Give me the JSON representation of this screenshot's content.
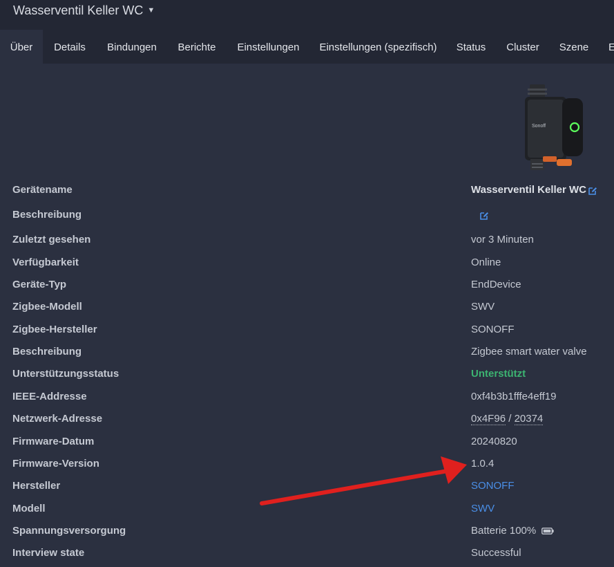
{
  "header": {
    "title": "Wasserventil Keller WC"
  },
  "tabs": [
    {
      "label": "Über",
      "active": true
    },
    {
      "label": "Details"
    },
    {
      "label": "Bindungen"
    },
    {
      "label": "Berichte"
    },
    {
      "label": "Einstellungen"
    },
    {
      "label": "Einstellungen (spezifisch)"
    },
    {
      "label": "Status"
    },
    {
      "label": "Cluster"
    },
    {
      "label": "Szene"
    },
    {
      "label": "E"
    }
  ],
  "device_image": {
    "brand_text": "Sonoff"
  },
  "info": {
    "geraetename": {
      "label": "Gerätename",
      "value": "Wasserventil Keller WC"
    },
    "beschreibung_edit": {
      "label": "Beschreibung"
    },
    "zuletzt": {
      "label": "Zuletzt gesehen",
      "value": "vor 3 Minuten"
    },
    "verfuegbarkeit": {
      "label": "Verfügbarkeit",
      "value": "Online"
    },
    "typ": {
      "label": "Geräte-Typ",
      "value": "EndDevice"
    },
    "modell": {
      "label": "Zigbee-Modell",
      "value": "SWV"
    },
    "hersteller_zb": {
      "label": "Zigbee-Hersteller",
      "value": "SONOFF"
    },
    "beschreibung": {
      "label": "Beschreibung",
      "value": "Zigbee smart water valve"
    },
    "support": {
      "label": "Unterstützungsstatus",
      "value": "Unterstützt"
    },
    "ieee": {
      "label": "IEEE-Addresse",
      "value": "0xf4b3b1fffe4eff19"
    },
    "netzwerk": {
      "label": "Netzwerk-Adresse",
      "hex": "0x4F96",
      "sep": " / ",
      "dec": "20374"
    },
    "fw_datum": {
      "label": "Firmware-Datum",
      "value": "20240820"
    },
    "fw_version": {
      "label": "Firmware-Version",
      "value": "1.0.4"
    },
    "hersteller": {
      "label": "Hersteller",
      "value": "SONOFF"
    },
    "modell2": {
      "label": "Modell",
      "value": "SWV"
    },
    "power": {
      "label": "Spannungsversorgung",
      "value": "Batterie 100%"
    },
    "interview": {
      "label": "Interview state",
      "value": "Successful"
    }
  },
  "colors": {
    "accent_link": "#4a8fe8",
    "supported_green": "#3cb371",
    "annotation_arrow": "#e0201e"
  },
  "icons": [
    "chevron-down-icon",
    "edit-icon",
    "battery-icon",
    "red-arrow-annotation"
  ]
}
